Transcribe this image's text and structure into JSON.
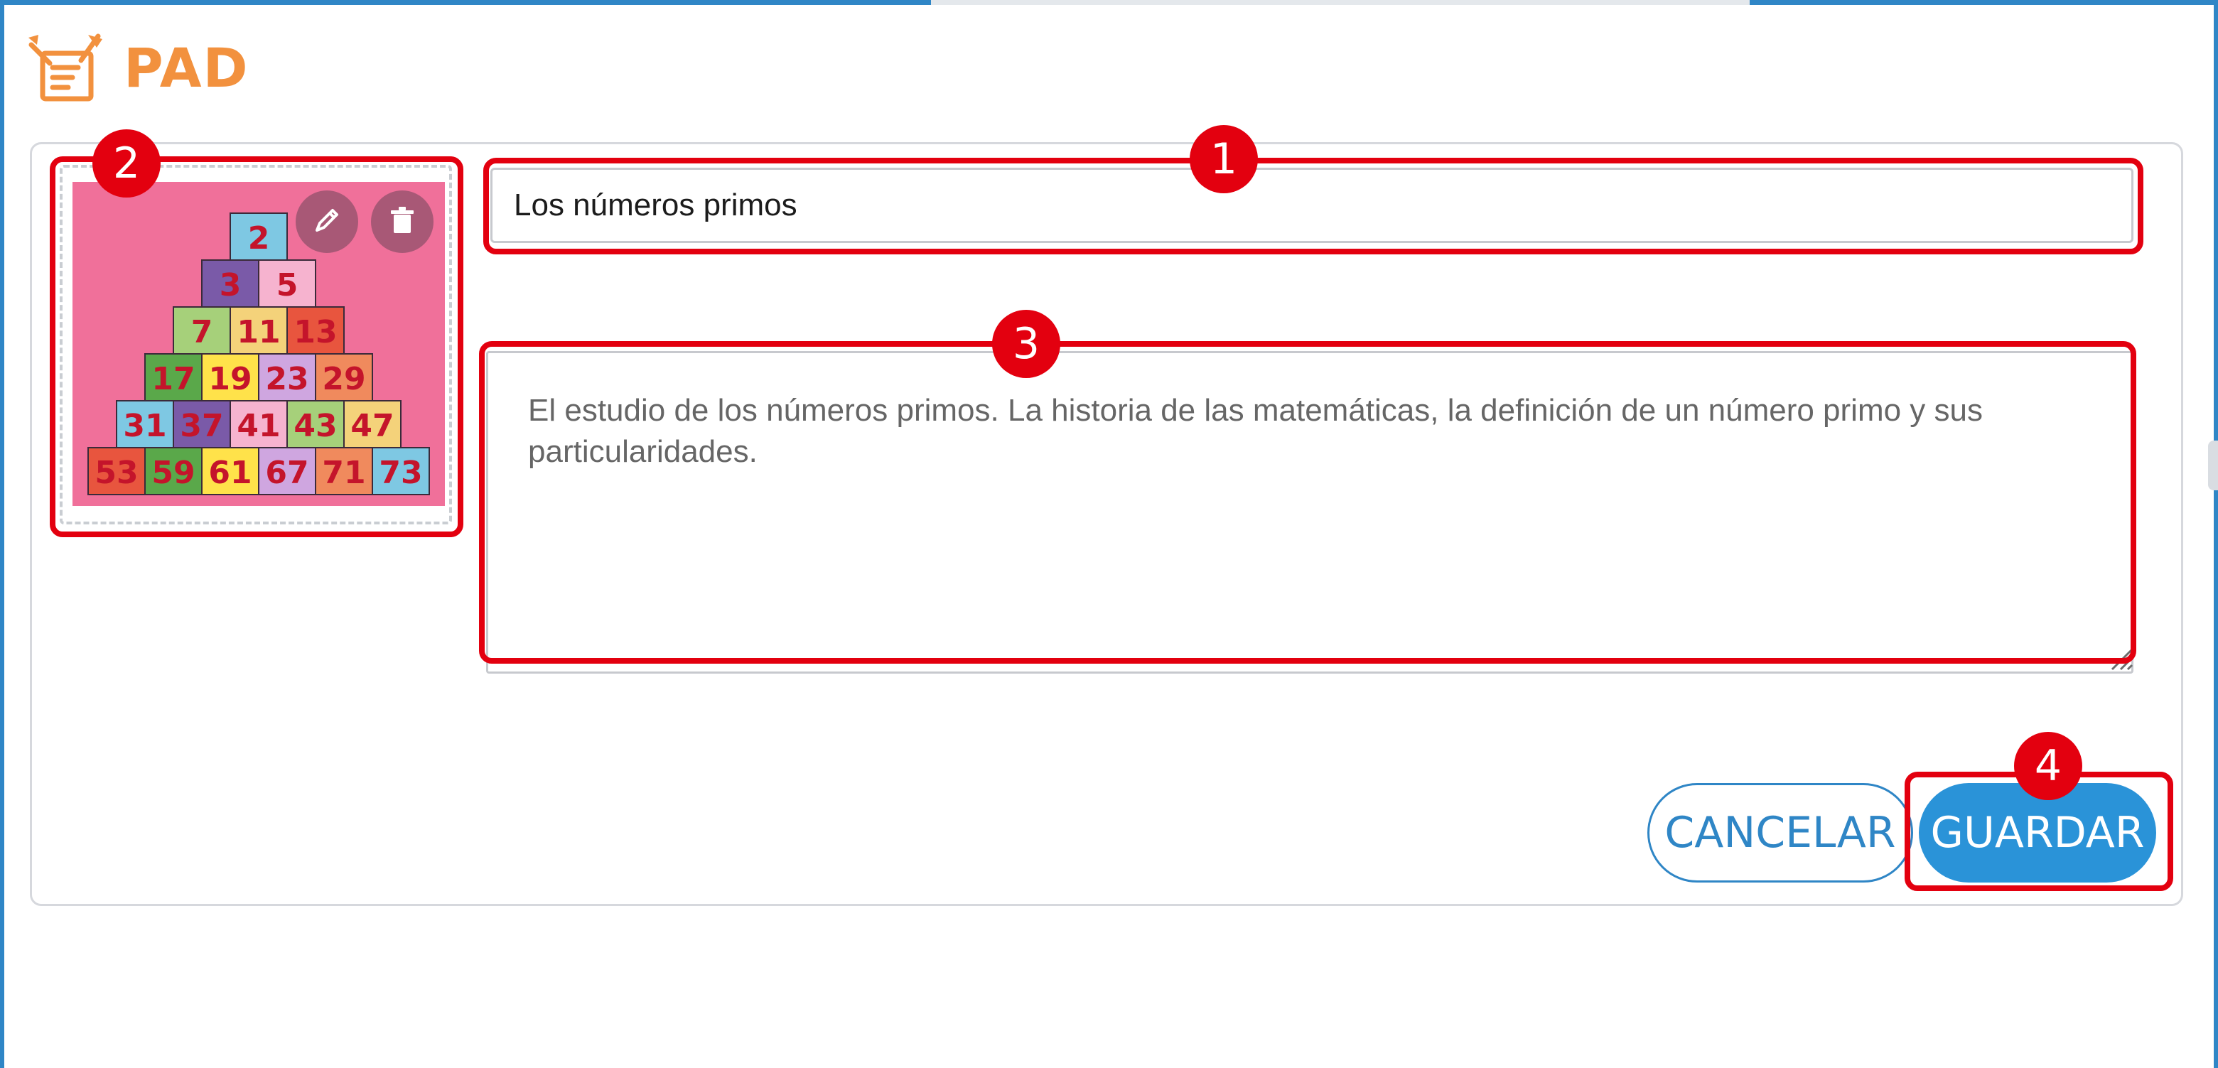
{
  "app": {
    "title": "PAD"
  },
  "form": {
    "title_value": "Los números primos",
    "description_value": "El estudio de los números primos. La historia de las matemáticas, la definición de un número primo y sus particularidades.",
    "thumbnail": {
      "rows": [
        [
          "2"
        ],
        [
          "3",
          "5"
        ],
        [
          "7",
          "11",
          "13"
        ],
        [
          "17",
          "19",
          "23",
          "29"
        ],
        [
          "31",
          "37",
          "41",
          "43",
          "47"
        ],
        [
          "53",
          "59",
          "61",
          "67",
          "71",
          "73"
        ]
      ],
      "background_color": "#f0709a"
    }
  },
  "buttons": {
    "cancel_label": "CANCELAR",
    "save_label": "GUARDAR"
  },
  "annotations": {
    "badge_1": "1",
    "badge_2": "2",
    "badge_3": "3",
    "badge_4": "4"
  },
  "icons": {
    "edit": "pencil-icon",
    "delete": "trash-icon",
    "logo": "pad-logo-icon"
  },
  "colors": {
    "accent": "#2f86c6",
    "brand": "#f2913e",
    "annotation": "#e3000f",
    "save_button": "#2a93d8"
  }
}
